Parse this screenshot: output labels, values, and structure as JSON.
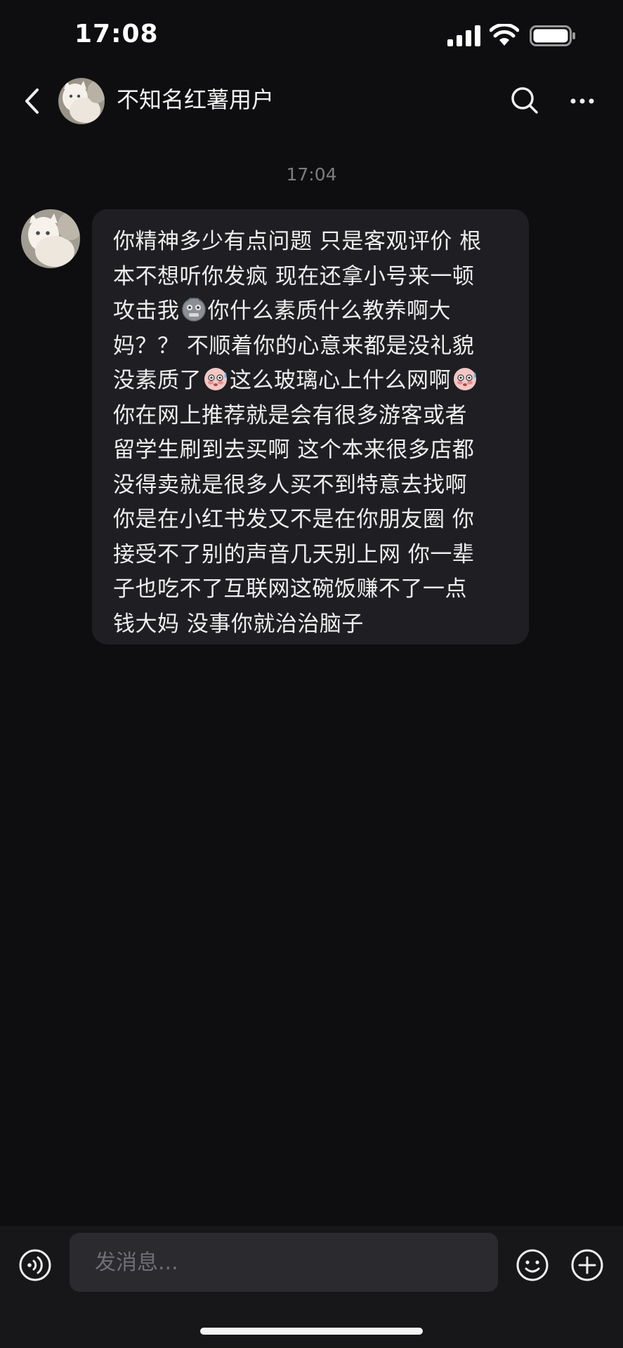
{
  "status_bar": {
    "time": "17:08",
    "icons": [
      "signal-icon",
      "wifi-icon",
      "battery-icon"
    ]
  },
  "header": {
    "contact_name": "不知名红薯用户",
    "icons": [
      "back-icon",
      "search-icon",
      "more-icon"
    ]
  },
  "conversation": {
    "timestamp": "17:04",
    "message": {
      "lines": [
        [
          "你精神多少有点问题 只是客观评价 根"
        ],
        [
          "本不想听你发疯 现在还拿小号来一顿"
        ],
        [
          "攻击我",
          {
            "emoji": "grimace-face-emoji"
          },
          "你什么素质什么教养啊大"
        ],
        [
          "妈？？ 不顺着你的心意来都是没礼貌"
        ],
        [
          "没素质了",
          {
            "emoji": "sweat-blush-emoji"
          },
          "这么玻璃心上什么网啊",
          {
            "emoji": "sweat-blush-emoji"
          }
        ],
        [
          "你在网上推荐就是会有很多游客或者"
        ],
        [
          "留学生刷到去买啊 这个本来很多店都"
        ],
        [
          "没得卖就是很多人买不到特意去找啊"
        ],
        [
          "你是在小红书发又不是在你朋友圈 你"
        ],
        [
          "接受不了别的声音几天别上网 你一辈"
        ],
        [
          "子也吃不了互联网这碗饭赚不了一点"
        ],
        [
          "钱大妈 没事你就治治脑子"
        ]
      ]
    }
  },
  "input_bar": {
    "placeholder": "发消息...",
    "value": "",
    "icons": [
      "voice-icon",
      "emoji-icon",
      "plus-icon"
    ]
  },
  "colors": {
    "background": "#0e0e10",
    "bubble": "#1f1f23",
    "input_bar": "#17171a",
    "input_field": "#2a2a2f",
    "text": "#eeeeee",
    "muted_text": "#7d7d82"
  }
}
